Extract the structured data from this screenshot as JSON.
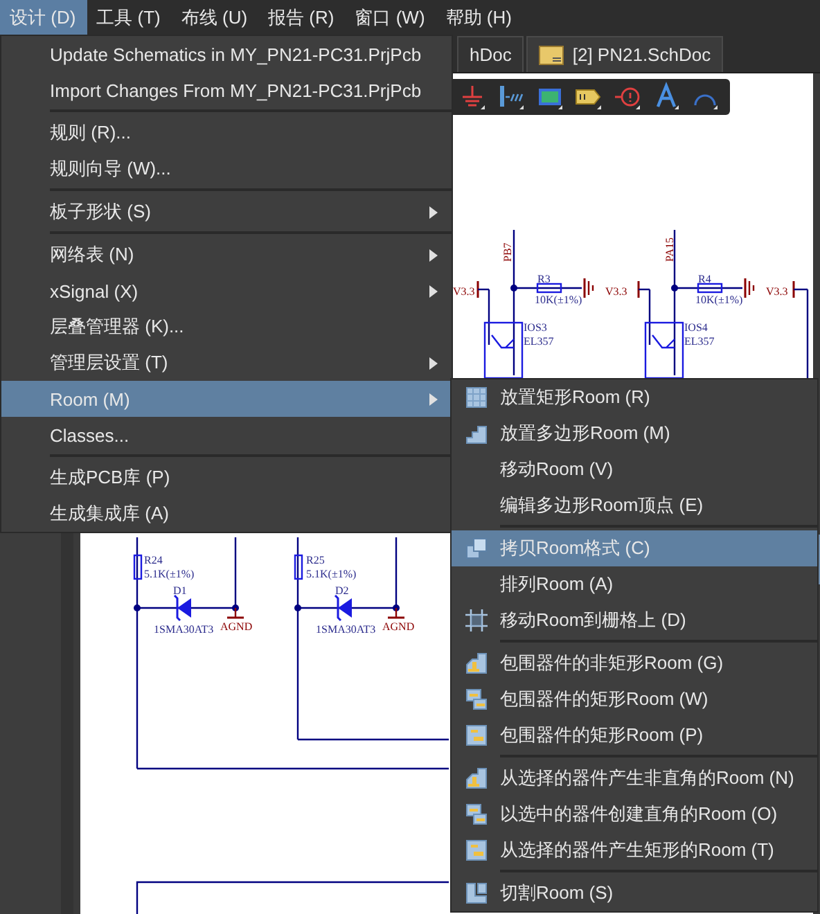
{
  "menubar": [
    {
      "label": "设计 (D)",
      "selected": true
    },
    {
      "label": "工具 (T)",
      "selected": false
    },
    {
      "label": "布线 (U)",
      "selected": false
    },
    {
      "label": "报告 (R)",
      "selected": false
    },
    {
      "label": "窗口 (W)",
      "selected": false
    },
    {
      "label": "帮助 (H)",
      "selected": false
    }
  ],
  "tabs": [
    {
      "label": "hDoc",
      "selected": false
    },
    {
      "label": "[2] PN21.SchDoc",
      "selected": true
    }
  ],
  "schematic": {
    "labels": [
      {
        "text": "PB7",
        "kind": "net"
      },
      {
        "text": "V3.3",
        "kind": "net"
      },
      {
        "text": "R3",
        "kind": "part"
      },
      {
        "text": "10K(±1%)",
        "kind": "part"
      },
      {
        "text": "IOS3",
        "kind": "part"
      },
      {
        "text": "EL357",
        "kind": "part"
      },
      {
        "text": "PA15",
        "kind": "net"
      },
      {
        "text": "V3.3",
        "kind": "net"
      },
      {
        "text": "R4",
        "kind": "part"
      },
      {
        "text": "10K(±1%)",
        "kind": "part"
      },
      {
        "text": "IOS4",
        "kind": "part"
      },
      {
        "text": "EL357",
        "kind": "part"
      },
      {
        "text": "V3.3",
        "kind": "net"
      },
      {
        "text": "R24",
        "kind": "part"
      },
      {
        "text": "5.1K(±1%)",
        "kind": "part"
      },
      {
        "text": "D1",
        "kind": "part"
      },
      {
        "text": "1SMA30AT3",
        "kind": "part"
      },
      {
        "text": "AGND",
        "kind": "net"
      },
      {
        "text": "R25",
        "kind": "part"
      },
      {
        "text": "5.1K(±1%)",
        "kind": "part"
      },
      {
        "text": "D2",
        "kind": "part"
      },
      {
        "text": "1SMA30AT3",
        "kind": "part"
      },
      {
        "text": "AGND",
        "kind": "net"
      }
    ]
  },
  "design_menu": {
    "groups": [
      [
        {
          "label": "Update Schematics in MY_PN21-PC31.PrjPcb",
          "selected": false,
          "has_submenu": false
        },
        {
          "label": "Import Changes From MY_PN21-PC31.PrjPcb",
          "selected": false,
          "has_submenu": false
        }
      ],
      [
        {
          "label": "规则 (R)...",
          "selected": false,
          "has_submenu": false
        },
        {
          "label": "规则向导 (W)...",
          "selected": false,
          "has_submenu": false
        }
      ],
      [
        {
          "label": "板子形状 (S)",
          "selected": false,
          "has_submenu": true
        }
      ],
      [
        {
          "label": "网络表 (N)",
          "selected": false,
          "has_submenu": true
        },
        {
          "label": "xSignal (X)",
          "selected": false,
          "has_submenu": true
        },
        {
          "label": "层叠管理器 (K)...",
          "selected": false,
          "has_submenu": false
        },
        {
          "label": "管理层设置 (T)",
          "selected": false,
          "has_submenu": true
        },
        {
          "label": "Room (M)",
          "selected": true,
          "has_submenu": true
        },
        {
          "label": "Classes...",
          "selected": false,
          "has_submenu": false
        }
      ],
      [
        {
          "label": "生成PCB库 (P)",
          "selected": false,
          "has_submenu": false
        },
        {
          "label": "生成集成库 (A)",
          "selected": false,
          "has_submenu": false
        }
      ]
    ]
  },
  "room_submenu": {
    "groups": [
      [
        {
          "label": "放置矩形Room (R)",
          "selected": false
        },
        {
          "label": "放置多边形Room (M)",
          "selected": false
        },
        {
          "label": "移动Room (V)",
          "selected": false
        },
        {
          "label": "编辑多边形Room顶点 (E)",
          "selected": false
        }
      ],
      [
        {
          "label": "拷贝Room格式 (C)",
          "selected": true
        },
        {
          "label": "排列Room (A)",
          "selected": false
        },
        {
          "label": "移动Room到栅格上 (D)",
          "selected": false
        }
      ],
      [
        {
          "label": "包围器件的非矩形Room (G)",
          "selected": false
        },
        {
          "label": "包围器件的矩形Room (W)",
          "selected": false
        },
        {
          "label": "包围器件的矩形Room (P)",
          "selected": false
        }
      ],
      [
        {
          "label": "从选择的器件产生非直角的Room (N)",
          "selected": false
        },
        {
          "label": "以选中的器件创建直角的Room (O)",
          "selected": false
        },
        {
          "label": "从选择的器件产生矩形的Room (T)",
          "selected": false
        }
      ],
      [
        {
          "label": "切割Room (S)",
          "selected": false
        }
      ]
    ]
  }
}
